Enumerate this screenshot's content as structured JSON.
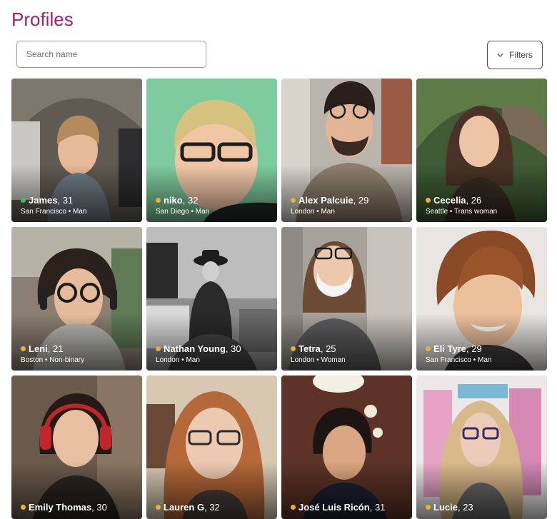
{
  "page": {
    "title": "Profiles"
  },
  "search": {
    "placeholder": "Search name",
    "value": ""
  },
  "filters": {
    "label": "Filters"
  },
  "colors": {
    "brand": "#a3206a",
    "online": "#3fbf5a",
    "recent": "#e9b037"
  },
  "profiles": [
    {
      "name": "James",
      "age": "31",
      "location": "San Francisco",
      "gender": "Man",
      "status": "online"
    },
    {
      "name": "niko",
      "age": "32",
      "location": "San Diego",
      "gender": "Man",
      "status": "recent"
    },
    {
      "name": "Alex Palcuie",
      "age": "29",
      "location": "London",
      "gender": "Man",
      "status": "recent"
    },
    {
      "name": "Cecelia",
      "age": "26",
      "location": "Seattle",
      "gender": "Trans woman",
      "status": "recent"
    },
    {
      "name": "Leni",
      "age": "21",
      "location": "Boston",
      "gender": "Non-binary",
      "status": "recent"
    },
    {
      "name": "Nathan Young",
      "age": "30",
      "location": "London",
      "gender": "Man",
      "status": "recent"
    },
    {
      "name": "Tetra",
      "age": "25",
      "location": "London",
      "gender": "Woman",
      "status": "recent"
    },
    {
      "name": "Eli Tyre",
      "age": "29",
      "location": "San Francisco",
      "gender": "Man",
      "status": "recent"
    },
    {
      "name": "Emily Thomas",
      "age": "30",
      "location": "",
      "gender": "",
      "status": "recent"
    },
    {
      "name": "Lauren G",
      "age": "32",
      "location": "",
      "gender": "",
      "status": "recent"
    },
    {
      "name": "José Luis Ricón",
      "age": "31",
      "location": "",
      "gender": "",
      "status": "recent"
    },
    {
      "name": "Lucie",
      "age": "23",
      "location": "",
      "gender": "",
      "status": "recent"
    }
  ]
}
